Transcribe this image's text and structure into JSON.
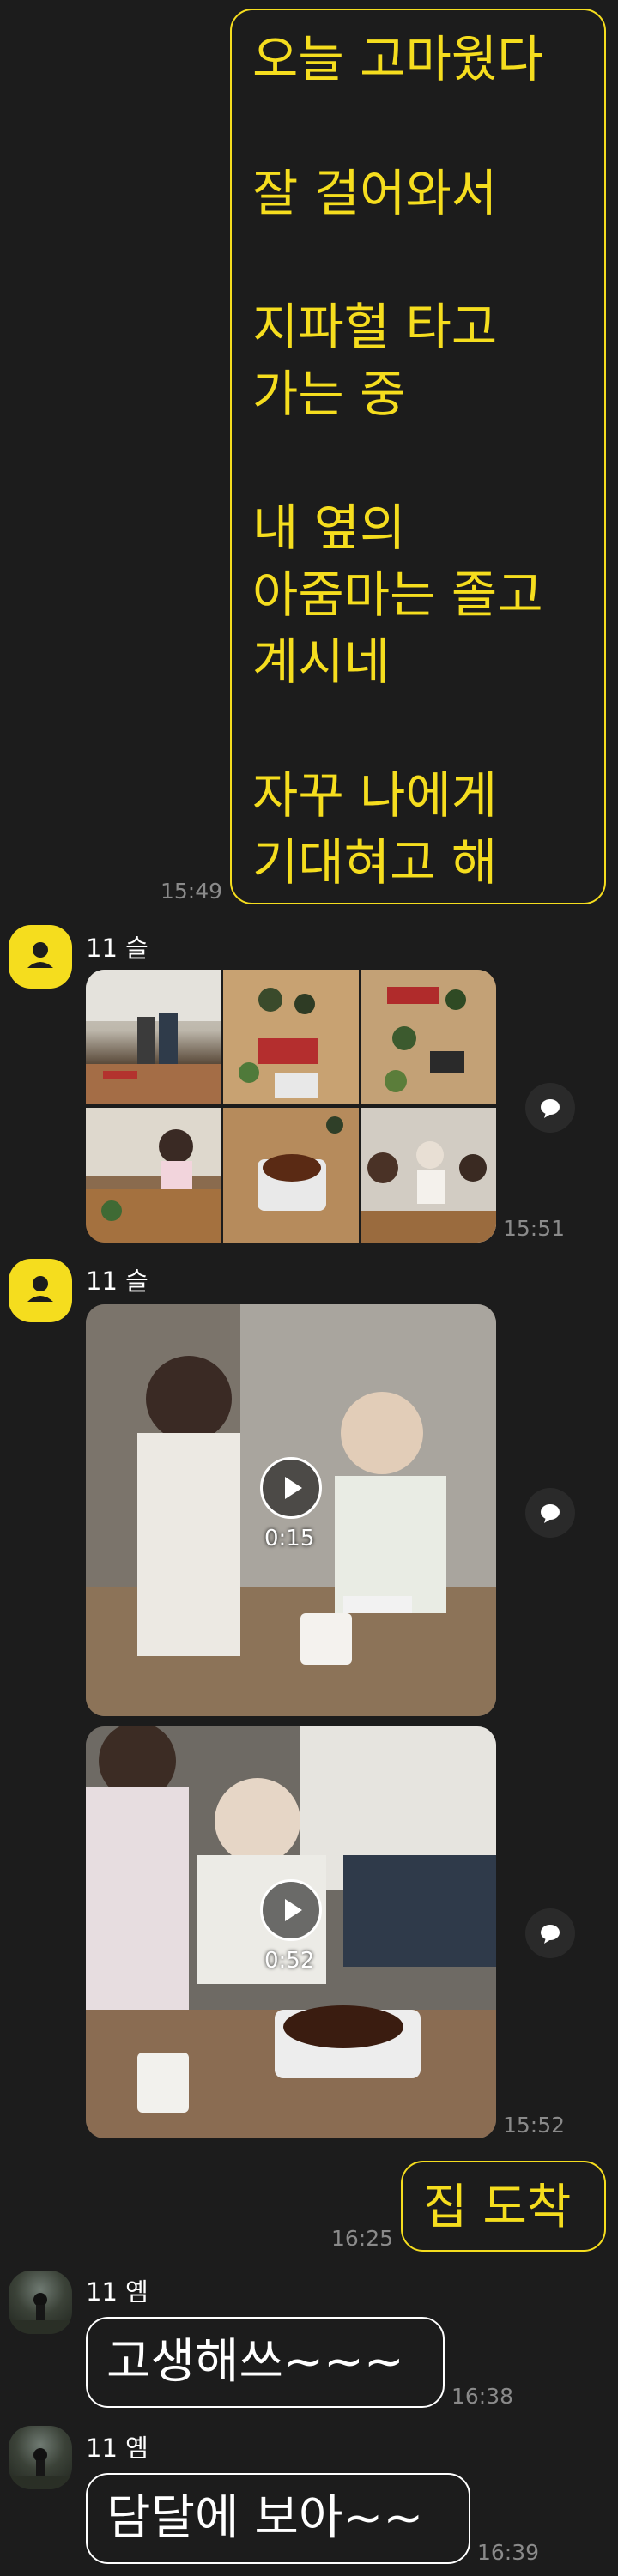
{
  "messages": {
    "m1": {
      "text": "오늘 고마웠다\n\n잘 걸어와서\n\n지파헐 타고\n가는 중\n\n내 옆의\n아줌마는 졸고\n계시네\n\n자꾸 나에게\n기대혀고 해",
      "time": "15:49"
    },
    "photos": {
      "sender": "11 슬",
      "time": "15:51",
      "count": 6
    },
    "video1": {
      "sender": "11 슬",
      "duration": "0:15"
    },
    "video2": {
      "duration": "0:52",
      "time": "15:52"
    },
    "m2": {
      "text": "집 도착",
      "time": "16:25"
    },
    "m3": {
      "sender": "11 옘",
      "text": "고생해쓰~~~",
      "time": "16:38"
    },
    "m4": {
      "sender": "11 옘",
      "text": "담달에 보아~~",
      "time": "16:39"
    }
  },
  "colors": {
    "background": "#1c1c1c",
    "accent": "#f5dd1e",
    "text": "#ffffff",
    "time": "#8a8a8a"
  },
  "icons": [
    "person-icon",
    "play-icon",
    "share-icon"
  ]
}
